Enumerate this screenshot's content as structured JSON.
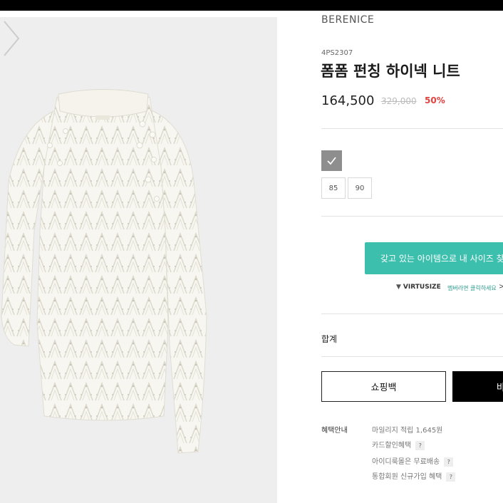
{
  "product": {
    "brand": "BERENICE",
    "code": "4PS2307",
    "name": "폼폼 펀칭 하이넥 니트",
    "price": "164,500",
    "original_price": "329,000",
    "discount": "50%"
  },
  "options": {
    "color_selected_icon": "check-icon",
    "sizes": [
      "85",
      "90"
    ]
  },
  "virtusize": {
    "button_label": "갖고 있는 아이템으로 내 사이즈 찾",
    "logo_text": "VIRTUSIZE",
    "link_text": "멤버라면 클릭하세요",
    "chevron": ">"
  },
  "total": {
    "label": "합계"
  },
  "actions": {
    "cart_label": "쇼핑백",
    "buy_label": "바"
  },
  "benefits": {
    "title": "혜택안내",
    "items": [
      {
        "text": "마일리지 적립 1,645원",
        "help": ""
      },
      {
        "text": "카드할인혜택",
        "help": "?"
      },
      {
        "text": "아이디룩몰은 무료배송",
        "help": "?"
      },
      {
        "text": "통합회원 신규가입 혜택",
        "help": "?"
      }
    ]
  },
  "colors": {
    "accent": "#3dbfae",
    "discount": "#e0433f",
    "gallery_bg": "#eeeeee",
    "swatch": "#8e8e8e"
  }
}
